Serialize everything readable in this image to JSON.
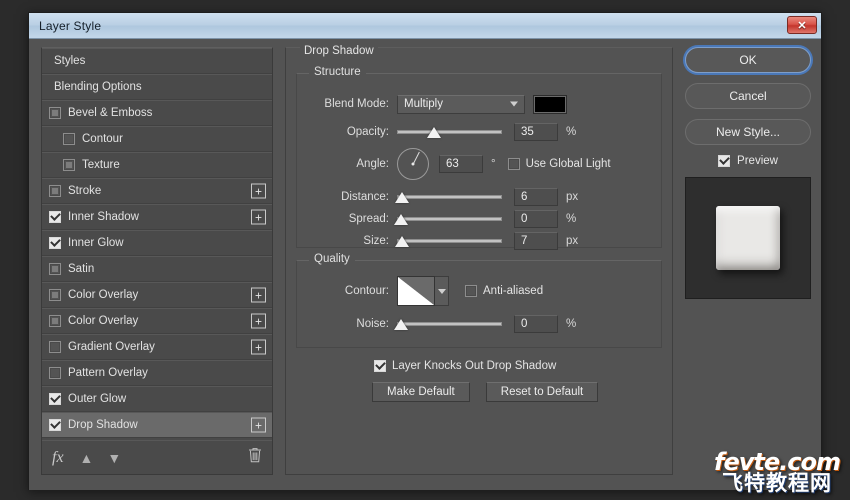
{
  "window": {
    "title": "Layer Style",
    "close_label": "✕"
  },
  "styles_panel": {
    "rows": [
      {
        "label": "Styles",
        "type": "header",
        "checkbox": "none",
        "plus": false,
        "selected": false,
        "indent": false
      },
      {
        "label": "Blending Options",
        "type": "header",
        "checkbox": "none",
        "plus": false,
        "selected": false,
        "indent": false
      },
      {
        "label": "Bevel & Emboss",
        "type": "effect",
        "checkbox": "semi",
        "plus": false,
        "selected": false,
        "indent": false
      },
      {
        "label": "Contour",
        "type": "sub",
        "checkbox": "off",
        "plus": false,
        "selected": false,
        "indent": true
      },
      {
        "label": "Texture",
        "type": "sub",
        "checkbox": "semi",
        "plus": false,
        "selected": false,
        "indent": true
      },
      {
        "label": "Stroke",
        "type": "effect",
        "checkbox": "semi",
        "plus": true,
        "selected": false,
        "indent": false
      },
      {
        "label": "Inner Shadow",
        "type": "effect",
        "checkbox": "on",
        "plus": true,
        "selected": false,
        "indent": false
      },
      {
        "label": "Inner Glow",
        "type": "effect",
        "checkbox": "on",
        "plus": false,
        "selected": false,
        "indent": false
      },
      {
        "label": "Satin",
        "type": "effect",
        "checkbox": "semi",
        "plus": false,
        "selected": false,
        "indent": false
      },
      {
        "label": "Color Overlay",
        "type": "effect",
        "checkbox": "semi",
        "plus": true,
        "selected": false,
        "indent": false
      },
      {
        "label": "Color Overlay",
        "type": "effect",
        "checkbox": "semi",
        "plus": true,
        "selected": false,
        "indent": false
      },
      {
        "label": "Gradient Overlay",
        "type": "effect",
        "checkbox": "off",
        "plus": true,
        "selected": false,
        "indent": false
      },
      {
        "label": "Pattern Overlay",
        "type": "effect",
        "checkbox": "off",
        "plus": false,
        "selected": false,
        "indent": false
      },
      {
        "label": "Outer Glow",
        "type": "effect",
        "checkbox": "on",
        "plus": false,
        "selected": false,
        "indent": false
      },
      {
        "label": "Drop Shadow",
        "type": "effect",
        "checkbox": "on",
        "plus": true,
        "selected": true,
        "indent": false
      }
    ],
    "footer": {
      "fx_label": "fx",
      "move_up_label": "▲",
      "move_down_label": "▼",
      "delete_label": "🗑"
    }
  },
  "center": {
    "panel_title": "Drop Shadow",
    "structure": {
      "group_label": "Structure",
      "blend_mode": {
        "label": "Blend Mode:",
        "value": "Multiply",
        "color": "#000000"
      },
      "opacity": {
        "label": "Opacity:",
        "value": "35",
        "unit": "%",
        "percent": 35
      },
      "angle": {
        "label": "Angle:",
        "value": "63",
        "unit": "°",
        "degrees": 63,
        "use_global_light_label": "Use Global Light",
        "use_global_light_checked": false
      },
      "distance": {
        "label": "Distance:",
        "value": "6",
        "unit": "px",
        "percent": 5
      },
      "spread": {
        "label": "Spread:",
        "value": "0",
        "unit": "%",
        "percent": 0
      },
      "size": {
        "label": "Size:",
        "value": "7",
        "unit": "px",
        "percent": 5
      }
    },
    "quality": {
      "group_label": "Quality",
      "contour": {
        "label": "Contour:"
      },
      "anti_aliased": {
        "label": "Anti-aliased",
        "checked": false
      },
      "noise": {
        "label": "Noise:",
        "value": "0",
        "unit": "%",
        "percent": 0
      }
    },
    "knockout": {
      "label": "Layer Knocks Out Drop Shadow",
      "checked": true
    },
    "make_default_label": "Make Default",
    "reset_default_label": "Reset to Default"
  },
  "right": {
    "ok_label": "OK",
    "cancel_label": "Cancel",
    "new_style_label": "New Style...",
    "preview_label": "Preview",
    "preview_checked": true
  },
  "watermark": {
    "line1": "fevte.com",
    "line2": "飞特教程网"
  }
}
